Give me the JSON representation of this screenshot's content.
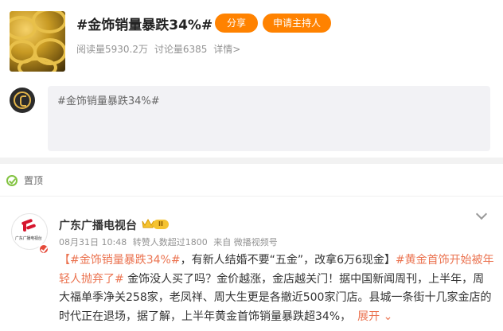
{
  "topic": {
    "title": "#金饰销量暴跌34%#",
    "share_label": "分享",
    "host_label": "申请主持人",
    "read_count": "阅读量5930.2万",
    "discuss_count": "讨论量6385",
    "detail_link": "详情>"
  },
  "composer": {
    "text": "#金饰销量暴跌34%#"
  },
  "feed": {
    "pin_label": "置顶",
    "author": {
      "name": "广东广播电视台",
      "level": "II",
      "avatar_caption": "广东广播电视台"
    },
    "meta": {
      "date": "08月31日 10:48",
      "likes": "转赞人数超过1800",
      "source": "来自 微播视频号"
    },
    "post": {
      "open_bracket": "【",
      "tag1": "#金饰销量暴跌34%#",
      "text1": "，有新人结婚不要“五金”，改拿6万6现金】",
      "tag2": "#黄金首饰开始被年轻人抛弃了#",
      "text2": " 金饰没人买了吗？金价越涨，金店越关门！据中国新闻周刊，上半年，周大福单季净关258家，老凤祥、周大生更是各撤近500家门店。县城一条街十几家金店的时代正在退场，据了解，上半年黄金首饰销量暴跌超34%，",
      "more_label": "展开"
    }
  },
  "colors": {
    "accent": "#ff8200",
    "highlight": "#eb7350",
    "pin_green": "#82c341"
  },
  "icons": [
    "gold-cover-image",
    "topic-host-avatar",
    "pin-icon",
    "verified-icon",
    "crown-icon",
    "chevron-down-icon"
  ]
}
